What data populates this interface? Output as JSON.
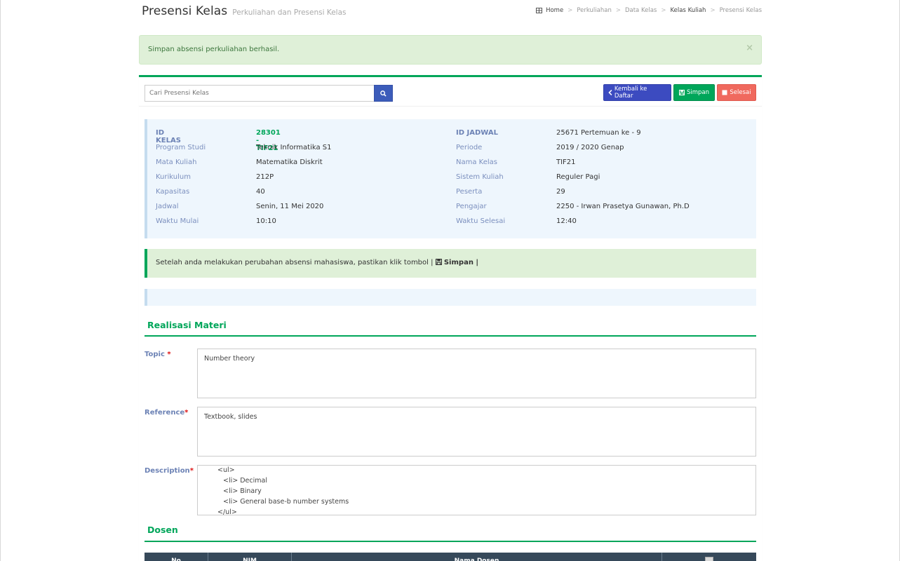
{
  "header": {
    "title": "Presensi Kelas",
    "subtitle": "Perkuliahan dan Presensi Kelas"
  },
  "breadcrumb": [
    "Home",
    "Perkuliahan",
    "Data Kelas",
    "Kelas Kuliah",
    "Presensi Kelas"
  ],
  "alert": {
    "message": "Simpan absensi perkuliahan berhasil.",
    "close": "×"
  },
  "toolbar": {
    "search_placeholder": "Cari Presensi Kelas",
    "back_label": "Kembali ke Daftar",
    "save_label": "Simpan",
    "done_label": "Selesai"
  },
  "info": {
    "left": [
      {
        "label": "ID KELAS",
        "value": "28301 - TIF21"
      },
      {
        "label": "Program Studi",
        "value": "Teknik Informatika S1"
      },
      {
        "label": "Mata Kuliah",
        "value": "Matematika Diskrit"
      },
      {
        "label": "Kurikulum",
        "value": "212P"
      },
      {
        "label": "Kapasitas",
        "value": "40"
      },
      {
        "label": "Jadwal",
        "value": "Senin, 11 Mei 2020"
      },
      {
        "label": "Waktu Mulai",
        "value": "10:10"
      }
    ],
    "right": [
      {
        "label": "ID JADWAL",
        "value": "25671 Pertemuan ke - 9"
      },
      {
        "label": "Periode",
        "value": "2019 / 2020 Genap"
      },
      {
        "label": "Nama Kelas",
        "value": "TIF21"
      },
      {
        "label": "Sistem Kuliah",
        "value": "Reguler Pagi"
      },
      {
        "label": "Peserta",
        "value": "29"
      },
      {
        "label": "Pengajar",
        "value": "2250 - Irwan Prasetya Gunawan, Ph.D"
      },
      {
        "label": "Waktu Selesai",
        "value": "12:40"
      }
    ]
  },
  "callout": {
    "text": "Setelah anda melakukan perubahan absensi mahasiswa, pastikan klik tombol |",
    "strong": "Simpan |"
  },
  "realisasi": {
    "title": "Realisasi Materi",
    "topic_label": "Topic",
    "topic_value": "Number theory",
    "reference_label": "Reference",
    "reference_value": "Textbook, slides",
    "description_label": "Description",
    "description_lines": [
      "<ul>",
      "<li> Decimal",
      "<li> Binary",
      "<li> General base-b number systems",
      "</ul>"
    ],
    "required_mark": "*"
  },
  "dosen": {
    "title": "Dosen",
    "columns": [
      "No",
      "NIM",
      "Nama Dosen",
      ""
    ]
  },
  "colors": {
    "accent_green": "#00a65a",
    "primary_blue": "#3c4bc0",
    "danger_red": "#f0695e",
    "label_blue": "#6c82b5",
    "table_header": "#36495a"
  }
}
